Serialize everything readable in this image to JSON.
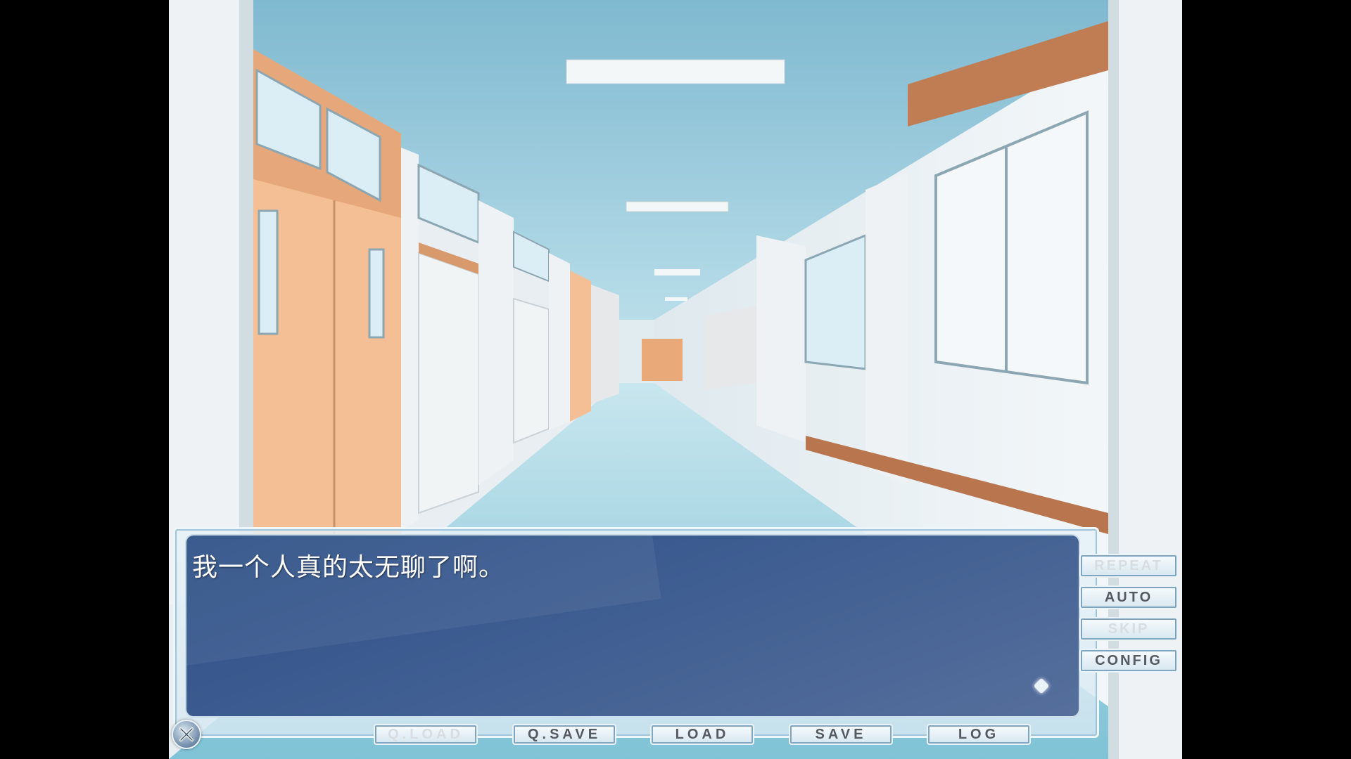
{
  "scene": {
    "name": "school-hallway"
  },
  "dialogue": {
    "text": "我一个人真的太无聊了啊。"
  },
  "side_menu": {
    "repeat": "REPEAT",
    "auto": "AUTO",
    "skip": "SKIP",
    "config": "CONFIG"
  },
  "bottom_menu": {
    "qload": "Q.LOAD",
    "qsave": "Q.SAVE",
    "load": "LOAD",
    "save": "SAVE",
    "log": "LOG"
  },
  "icons": {
    "close": "close-icon",
    "next": "next-page-indicator-icon"
  },
  "colors": {
    "textbox": "#3e5d91",
    "ceiling": "#8ec3d8",
    "floor": "#a9d9e6",
    "door": "#f0b98a",
    "button_text": "#555a60",
    "button_disabled_text": "#d8dde2"
  }
}
